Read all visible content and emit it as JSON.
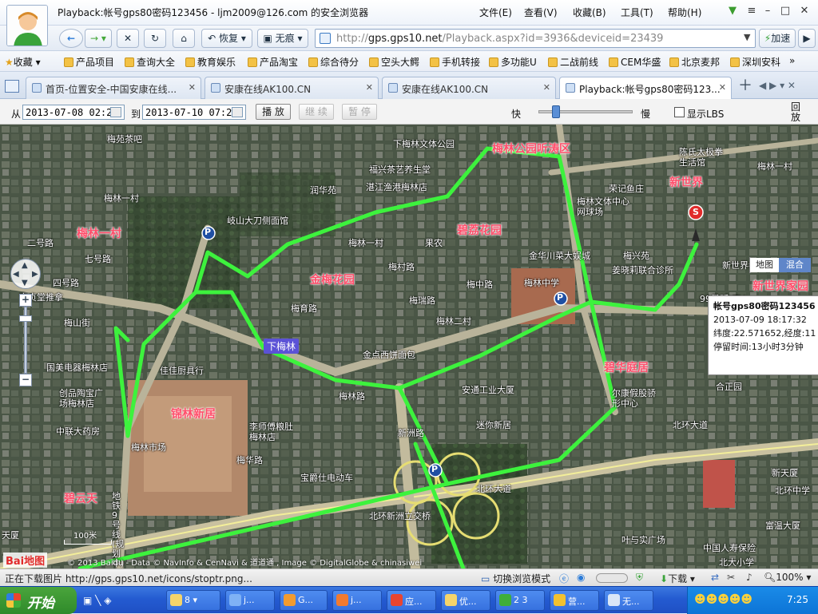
{
  "window": {
    "title": "Playback:帐号gps80密码123456 - ljm2009@126.com 的安全浏览器",
    "menus": [
      "文件(E)",
      "查看(V)",
      "收藏(B)",
      "工具(T)",
      "帮助(H)"
    ]
  },
  "nav": {
    "restore_label": "恢复",
    "traceless_label": "无痕",
    "url_prefix": "http://",
    "url_host": "gps.gps10.net",
    "url_path": "/Playback.aspx?id=3936&deviceid=23439",
    "speedup_label": "加速"
  },
  "favorites": [
    "收藏",
    "产品项目",
    "查询大全",
    "教育娱乐",
    "产品淘宝",
    "综合待分",
    "空头大鳄",
    "手机转接",
    "多功能U",
    "二战前线",
    "CEM华盛",
    "北京麦邦",
    "深圳安科"
  ],
  "tabs": [
    {
      "label": "首页-位置安全-中国安康在线..."
    },
    {
      "label": "安康在线AK100.CN"
    },
    {
      "label": "安康在线AK100.CN"
    },
    {
      "label": "Playback:帐号gps80密码123..."
    }
  ],
  "toolbar": {
    "from_label": "从",
    "from_value": "2013-07-08 02:21",
    "to_label": "到",
    "to_value": "2013-07-10 07:21",
    "play_label": "播 放",
    "continue_label": "继 续",
    "pause_label": "暂 停",
    "fast_label": "快",
    "slow_label": "慢",
    "speed_slider_value": 0.15,
    "show_lbs_label": "显示LBS",
    "playback_label": "回放"
  },
  "map": {
    "maptype_map": "地图",
    "maptype_hybrid": "混合",
    "scale_label": "100米",
    "copyright": "© 2013 Baidu - Data © NavInfo & CenNavi & 道道通 , Image © DigitalGlobe & chinasiwei",
    "brand": "Bai地图",
    "labels_big": [
      "梅林一村",
      "金梅花园",
      "碧荔花园",
      "锦林新居",
      "碧云天",
      "碧华庭居",
      "梅林公园听涛区",
      "新世界家园",
      "新世界"
    ],
    "labels_small": [
      "梅苑茶吧",
      "下梅林文体公园",
      "福兴茶艺养生堂",
      "湛江渔港梅林店",
      "润华苑",
      "岐山大刀侧面馆",
      "梅林一村",
      "果农",
      "荣记鱼庄",
      "梅林文体中心网球场",
      "金华川菜大娱城",
      "梅兴苑",
      "姜晓莉联合诊所",
      "梅林中学",
      "梅林二村",
      "金点西饼面包",
      "安通工业大厦",
      "迷你新居",
      "安贞堂推拿",
      "国美电器梅林店",
      "佳佳厨具行",
      "创品陶宝广场梅林店",
      "中联大药房",
      "梅林市场",
      "李师傅粮肚梅林店",
      "宝爵仕电动车",
      "梅林路",
      "梅育路",
      "梅华路",
      "梅山街",
      "四号路",
      "七号路",
      "二号路",
      "新洲路",
      "北环大道",
      "北环新洲立交桥",
      "北环大道",
      "地铁9号线(规划中)",
      "梅瑞路",
      "梅中路",
      "梅村路",
      "梅林一村",
      "下梅林",
      "陈氏太极拳生活馆",
      "梅林一村",
      "新世界都汇酒店",
      "99量贩KTV",
      "合正园",
      "尔康假股骄形中心",
      "新天厦",
      "北环中学",
      "富温大厦",
      "叶与实广场",
      "中国人寿保险",
      "北大小学",
      "天厦"
    ],
    "popup": {
      "title": "帐号gps80密码123456",
      "time": "2013-07-09 18:17:32",
      "coords": "纬度:22.571652,经度:11",
      "stay": "停留时间:13小时3分钟"
    }
  },
  "status": {
    "text": "正在下载图片 http://gps.gps10.net/icons/stoptr.png...",
    "browse_mode": "切换浏览模式",
    "download": "下载",
    "zoom": "100%"
  },
  "taskbar": {
    "start": "开始",
    "items": [
      "8 ▾",
      "j...",
      "G...",
      "j...",
      "应...",
      "优...",
      "2 3",
      "营...",
      "无..."
    ],
    "clock": "7:25"
  },
  "colors": {
    "route": "#3df23d",
    "accent": "#1e5bc6"
  }
}
